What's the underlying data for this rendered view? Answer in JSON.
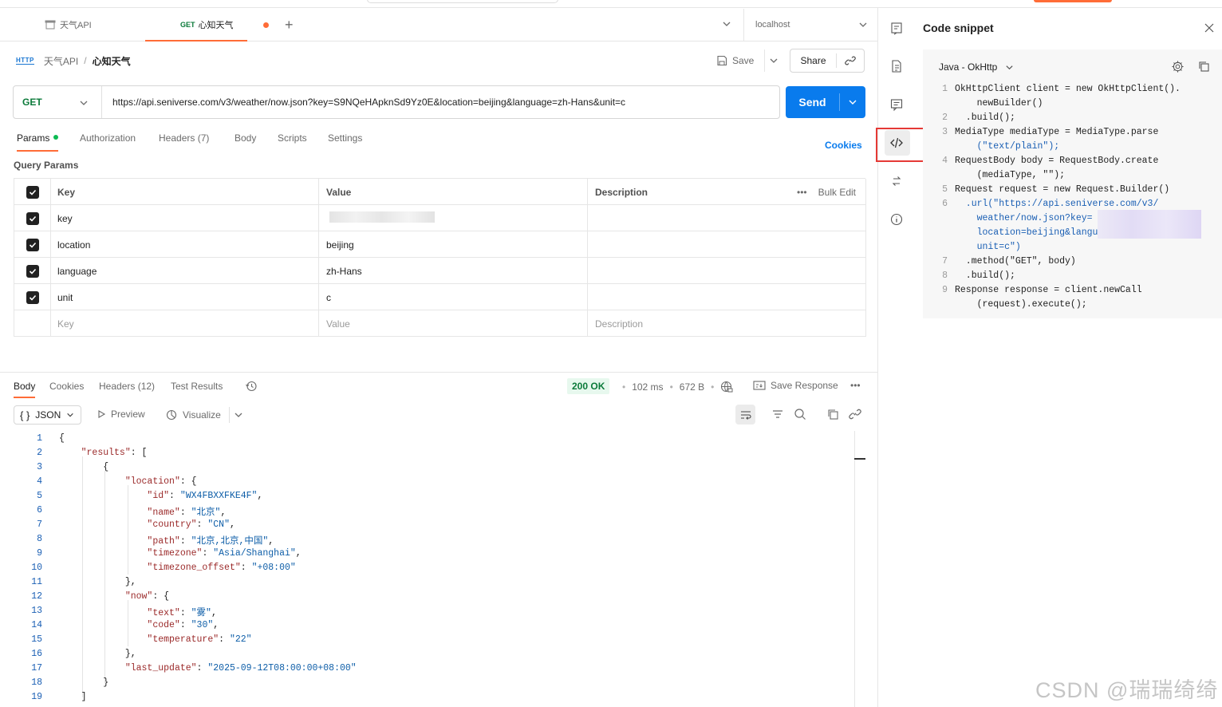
{
  "tabs": [
    {
      "label": "天气API",
      "kind": "collection"
    },
    {
      "method": "GET",
      "label": "心知天气",
      "unsaved": true
    }
  ],
  "environment": "localhost",
  "breadcrumb": {
    "badge": "HTTP",
    "parent": "天气API",
    "sep": "/",
    "current": "心知天气"
  },
  "actions": {
    "save": "Save",
    "share": "Share"
  },
  "request": {
    "method": "GET",
    "url": "https://api.seniverse.com/v3/weather/now.json?key=S9NQeHApknSd9Yz0E&location=beijing&language=zh-Hans&unit=c",
    "send": "Send"
  },
  "request_tabs": [
    "Params",
    "Authorization",
    "Headers (7)",
    "Body",
    "Scripts",
    "Settings"
  ],
  "cookies_link": "Cookies",
  "query_params": {
    "title": "Query Params",
    "headers": {
      "key": "Key",
      "value": "Value",
      "description": "Description",
      "bulk_edit": "Bulk Edit"
    },
    "rows": [
      {
        "key": "key",
        "value": "",
        "checked": true
      },
      {
        "key": "location",
        "value": "beijing",
        "checked": true
      },
      {
        "key": "language",
        "value": "zh-Hans",
        "checked": true
      },
      {
        "key": "unit",
        "value": "c",
        "checked": true
      }
    ],
    "placeholder": {
      "key": "Key",
      "value": "Value",
      "description": "Description"
    }
  },
  "response": {
    "tabs": [
      "Body",
      "Cookies",
      "Headers (12)",
      "Test Results"
    ],
    "status": "200 OK",
    "time": "102 ms",
    "size": "672 B",
    "save_response": "Save Response",
    "format": "JSON",
    "preview": "Preview",
    "visualize": "Visualize"
  },
  "json_lines": [
    "{",
    "    \"results\": [",
    "        {",
    "            \"location\": {",
    "                \"id\": \"WX4FBXXFKE4F\",",
    "                \"name\": \"北京\",",
    "                \"country\": \"CN\",",
    "                \"path\": \"北京,北京,中国\",",
    "                \"timezone\": \"Asia/Shanghai\",",
    "                \"timezone_offset\": \"+08:00\"",
    "            },",
    "            \"now\": {",
    "                \"text\": \"雾\",",
    "                \"code\": \"30\",",
    "                \"temperature\": \"22\"",
    "            },",
    "            \"last_update\": \"2025-09-12T08:00:00+08:00\"",
    "        }",
    "    ]"
  ],
  "snippet": {
    "title": "Code snippet",
    "language": "Java - OkHttp",
    "lines": [
      {
        "n": "1",
        "text": "OkHttpClient client = new OkHttpClient()."
      },
      {
        "n": "",
        "text": "    newBuilder()"
      },
      {
        "n": "2",
        "text": "  .build();"
      },
      {
        "n": "3",
        "text": "MediaType mediaType = MediaType.parse"
      },
      {
        "n": "",
        "text": "    (\"text/plain\");"
      },
      {
        "n": "4",
        "text": "RequestBody body = RequestBody.create"
      },
      {
        "n": "",
        "text": "    (mediaType, \"\");"
      },
      {
        "n": "5",
        "text": "Request request = new Request.Builder()"
      },
      {
        "n": "6",
        "text": "  .url(\"https://api.seniverse.com/v3/"
      },
      {
        "n": "",
        "text": "    weather/now.json?key="
      },
      {
        "n": "",
        "text": "    location=beijing&language=zh-Hans&"
      },
      {
        "n": "",
        "text": "    unit=c\")"
      },
      {
        "n": "7",
        "text": "  .method(\"GET\", body)"
      },
      {
        "n": "8",
        "text": "  .build();"
      },
      {
        "n": "9",
        "text": "Response response = client.newCall"
      },
      {
        "n": "",
        "text": "    (request).execute();"
      }
    ]
  },
  "watermark": "CSDN @瑞瑞绮绮"
}
